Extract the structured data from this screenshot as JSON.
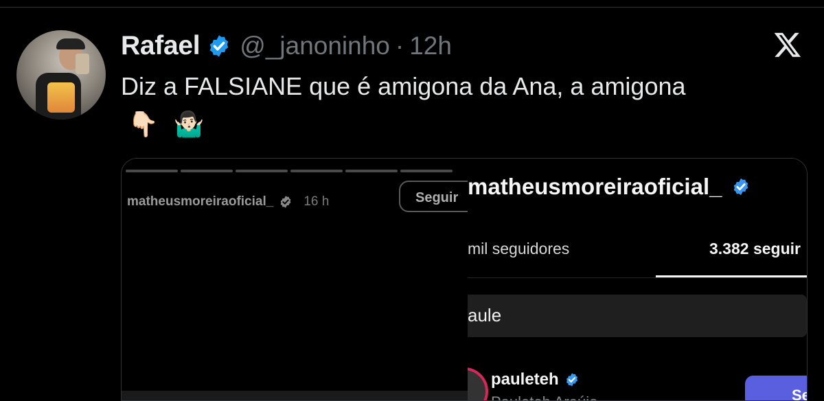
{
  "tweet": {
    "name": "Rafael",
    "handle": "@_janoninho",
    "separator": "·",
    "time": "12h",
    "text": "Diz a FALSIANE que é amigona da Ana, a amigona",
    "emoji_1": "👇🏻",
    "emoji_2": "🤷🏻‍♂️"
  },
  "media": {
    "story": {
      "username": "matheusmoreiraoficial_",
      "time": "16 h",
      "follow_label": "Seguir"
    },
    "profile": {
      "username": "matheusmoreiraoficial_",
      "followers_tab": "mil seguidores",
      "following_tab": "3.382 seguir",
      "search_text": "aule",
      "result_username": "pauleteh",
      "result_subtitle": "Pauleteh Araújo",
      "follow_label": "Se"
    }
  },
  "colors": {
    "background": "#000000",
    "verified_blue": "#1d9bf0",
    "muted_text": "#71767b",
    "follow_button": "#5a5fe0"
  },
  "icons": {
    "logo": "x-logo-icon",
    "verified": "verified-badge-icon"
  }
}
